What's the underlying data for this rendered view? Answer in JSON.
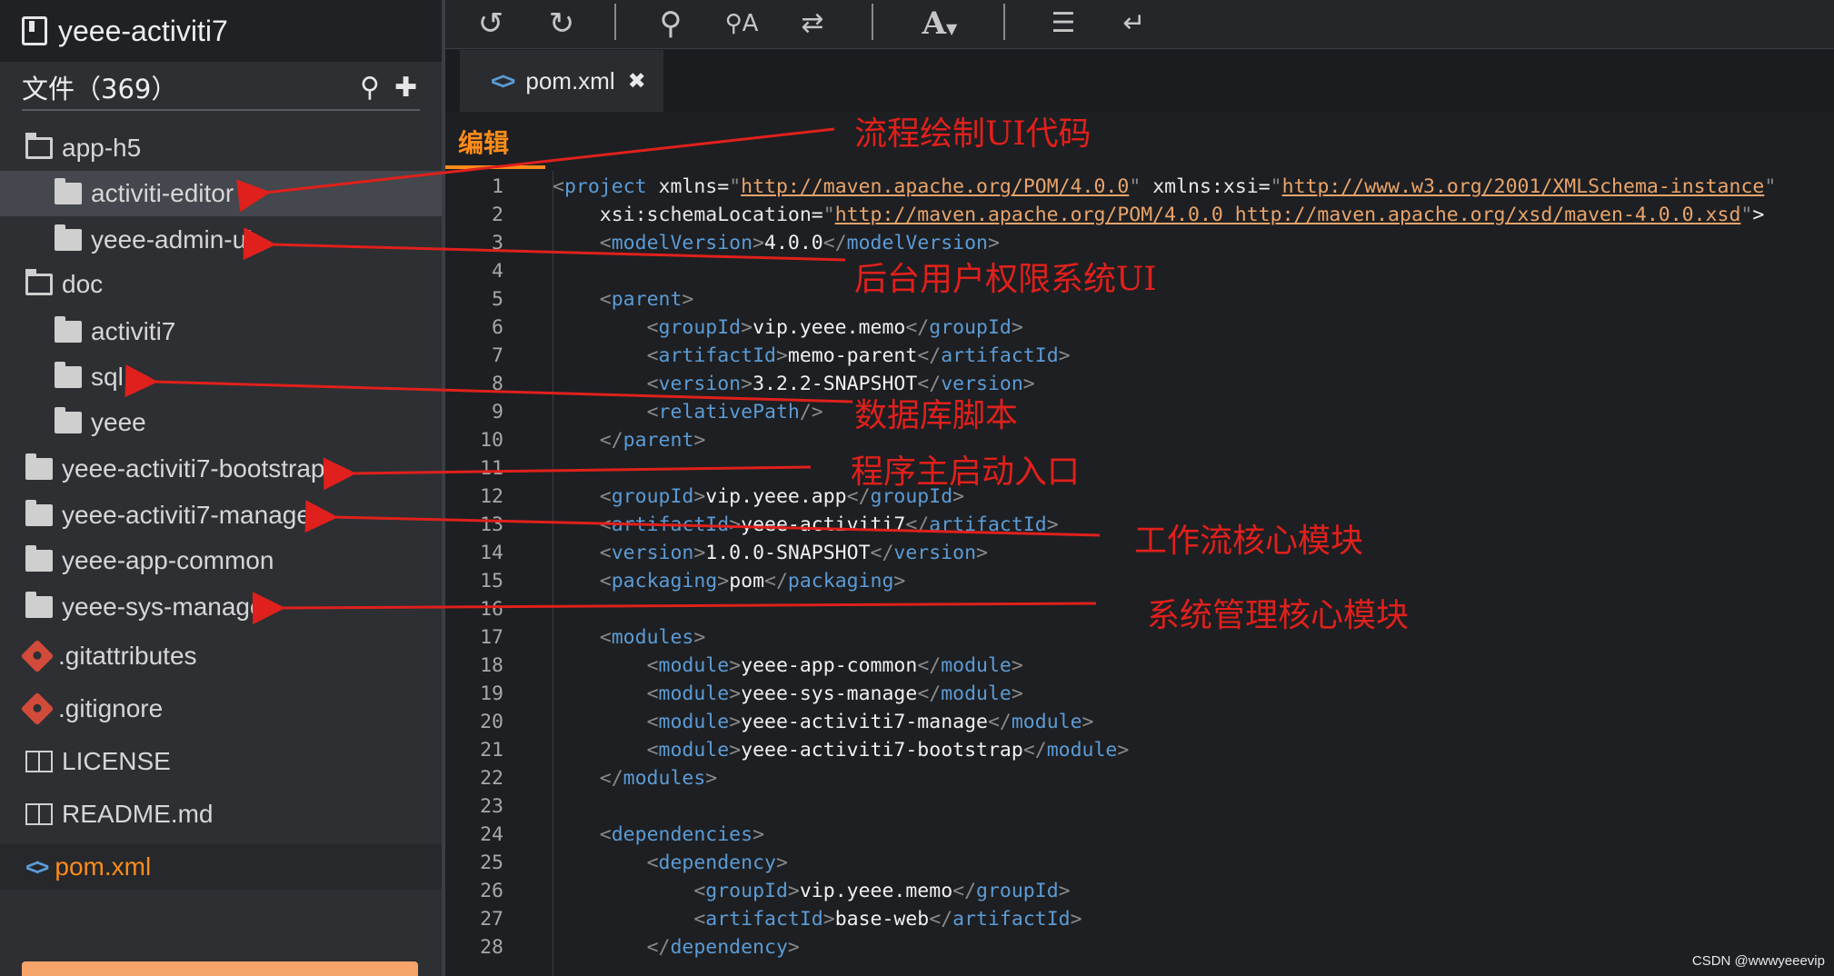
{
  "sidebar": {
    "project_title": "yeee-activiti7",
    "files_label": "文件（369）",
    "tree": [
      {
        "label": "app-h5",
        "icon": "folder-open-icon",
        "name": "tree-folder-app-h5"
      },
      {
        "label": "activiti-editor",
        "icon": "folder-icon",
        "name": "tree-folder-activiti-editor"
      },
      {
        "label": "yeee-admin-ui",
        "icon": "folder-icon",
        "name": "tree-folder-yeee-admin-ui"
      },
      {
        "label": "doc",
        "icon": "folder-open-icon",
        "name": "tree-folder-doc"
      },
      {
        "label": "activiti7",
        "icon": "folder-icon",
        "name": "tree-folder-activiti7"
      },
      {
        "label": "sql",
        "icon": "folder-icon",
        "name": "tree-folder-sql"
      },
      {
        "label": "yeee",
        "icon": "folder-icon",
        "name": "tree-folder-yeee"
      },
      {
        "label": "yeee-activiti7-bootstrap",
        "icon": "folder-icon",
        "name": "tree-folder-bootstrap"
      },
      {
        "label": "yeee-activiti7-manage",
        "icon": "folder-icon",
        "name": "tree-folder-manage"
      },
      {
        "label": "yeee-app-common",
        "icon": "folder-icon",
        "name": "tree-folder-app-common"
      },
      {
        "label": "yeee-sys-manage",
        "icon": "folder-icon",
        "name": "tree-folder-sys-manage"
      },
      {
        "label": ".gitattributes",
        "icon": "git-icon",
        "name": "tree-file-gitattributes"
      },
      {
        "label": ".gitignore",
        "icon": "git-icon",
        "name": "tree-file-gitignore"
      },
      {
        "label": "LICENSE",
        "icon": "book-icon",
        "name": "tree-file-license"
      },
      {
        "label": "README.md",
        "icon": "book-icon",
        "name": "tree-file-readme"
      },
      {
        "label": "pom.xml",
        "icon": "code-icon",
        "name": "tree-file-pom"
      }
    ]
  },
  "toolbar": {
    "undo_icon": "undo-icon",
    "redo_icon": "redo-icon",
    "search_icon": "search-icon",
    "replace_icon": "search-replace-icon",
    "shuffle_icon": "shuffle-icon",
    "font_icon": "font-size-icon",
    "list_icon": "list-icon",
    "wrap_icon": "wrap-icon"
  },
  "tab": {
    "label": "pom.xml"
  },
  "editor": {
    "mode_label": "编辑"
  },
  "code_lines": [
    [
      "1",
      "<project xmlns=\"http://maven.apache.org/POM/4.0.0\" xmlns:xsi=\"http://www.w3.org/2001/XMLSchema-instance\""
    ],
    [
      "2",
      "    xsi:schemaLocation=\"http://maven.apache.org/POM/4.0.0 http://maven.apache.org/xsd/maven-4.0.0.xsd\">"
    ],
    [
      "3",
      "    <modelVersion>4.0.0</modelVersion>"
    ],
    [
      "4",
      ""
    ],
    [
      "5",
      "    <parent>"
    ],
    [
      "6",
      "        <groupId>vip.yeee.memo</groupId>"
    ],
    [
      "7",
      "        <artifactId>memo-parent</artifactId>"
    ],
    [
      "8",
      "        <version>3.2.2-SNAPSHOT</version>"
    ],
    [
      "9",
      "        <relativePath/>"
    ],
    [
      "10",
      "    </parent>"
    ],
    [
      "11",
      ""
    ],
    [
      "12",
      "    <groupId>vip.yeee.app</groupId>"
    ],
    [
      "13",
      "    <artifactId>yeee-activiti7</artifactId>"
    ],
    [
      "14",
      "    <version>1.0.0-SNAPSHOT</version>"
    ],
    [
      "15",
      "    <packaging>pom</packaging>"
    ],
    [
      "16",
      ""
    ],
    [
      "17",
      "    <modules>"
    ],
    [
      "18",
      "        <module>yeee-app-common</module>"
    ],
    [
      "19",
      "        <module>yeee-sys-manage</module>"
    ],
    [
      "20",
      "        <module>yeee-activiti7-manage</module>"
    ],
    [
      "21",
      "        <module>yeee-activiti7-bootstrap</module>"
    ],
    [
      "22",
      "    </modules>"
    ],
    [
      "23",
      ""
    ],
    [
      "24",
      "    <dependencies>"
    ],
    [
      "25",
      "        <dependency>"
    ],
    [
      "26",
      "            <groupId>vip.yeee.memo</groupId>"
    ],
    [
      "27",
      "            <artifactId>base-web</artifactId>"
    ],
    [
      "28",
      "        </dependency>"
    ]
  ],
  "annotations": [
    {
      "text": "流程绘制UI代码"
    },
    {
      "text": "后台用户权限系统UI"
    },
    {
      "text": "数据库脚本"
    },
    {
      "text": "程序主启动入口"
    },
    {
      "text": "工作流核心模块"
    },
    {
      "text": "系统管理核心模块"
    }
  ],
  "watermark": "CSDN @wwwyeeevip"
}
